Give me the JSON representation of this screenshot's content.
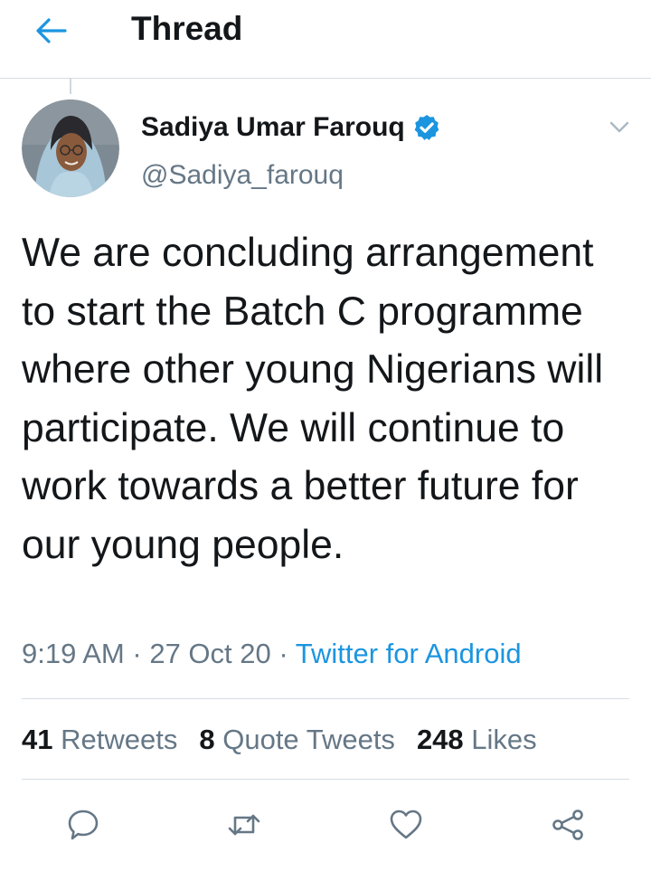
{
  "header": {
    "title": "Thread",
    "back_icon": "arrow-left-icon"
  },
  "tweet": {
    "author": {
      "name": "Sadiya Umar Farouq",
      "handle": "@Sadiya_farouq",
      "verified_icon": "verified-badge-icon"
    },
    "text": "We are concluding arrangement to start the Batch C programme where other young Nigerians will participate. We will continue to work towards a better future for our young people.",
    "time": "9:19 AM",
    "date": "27 Oct 20",
    "separator": "·",
    "client": "Twitter for Android"
  },
  "stats": {
    "retweets_count": "41",
    "retweets_label": "Retweets",
    "quotes_count": "8",
    "quotes_label": "Quote Tweets",
    "likes_count": "248",
    "likes_label": "Likes"
  },
  "actions": [
    "reply-icon",
    "retweet-icon",
    "like-icon",
    "share-icon"
  ],
  "colors": {
    "accent": "#1b95e0",
    "text": "#14171a",
    "muted": "#657786",
    "divider": "#d6dde3"
  }
}
